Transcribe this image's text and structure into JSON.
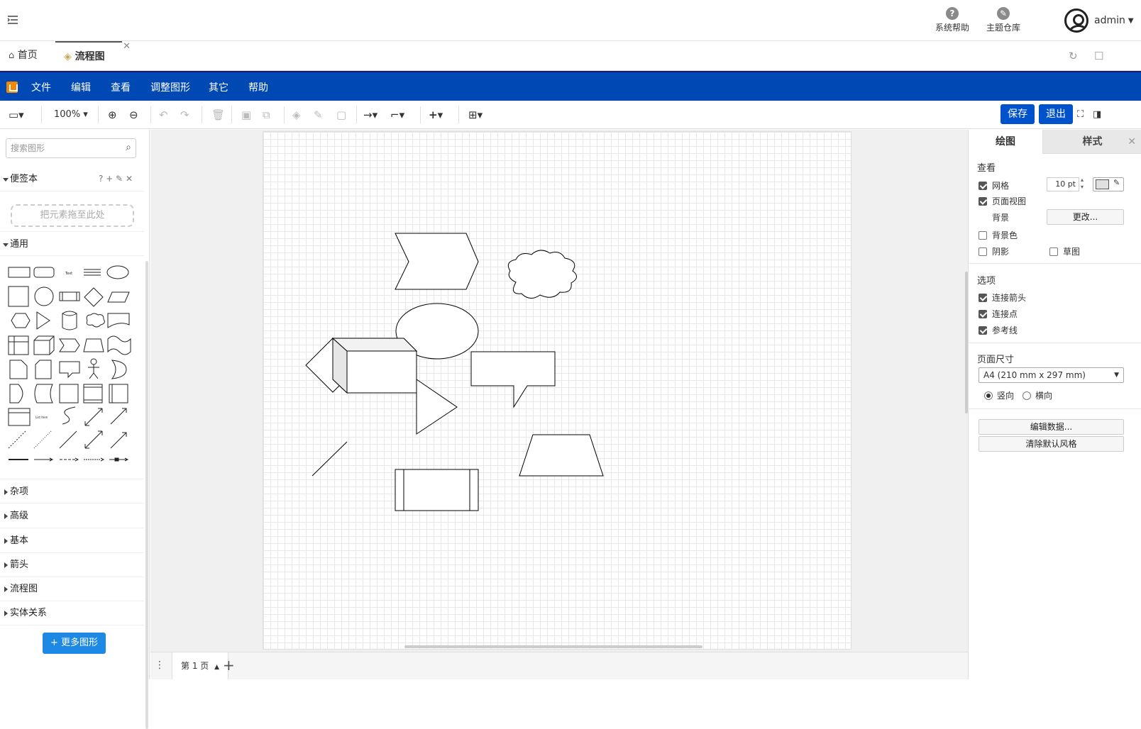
{
  "topbar": {
    "help_label": "系统帮助",
    "theme_label": "主题仓库",
    "user_name": "admin"
  },
  "tabs": [
    {
      "label": "首页"
    },
    {
      "label": "流程图"
    }
  ],
  "menubar": {
    "items": [
      "文件",
      "编辑",
      "查看",
      "调整图形",
      "其它",
      "帮助"
    ]
  },
  "toolbar": {
    "zoom": "100%",
    "save_label": "保存",
    "exit_label": "退出"
  },
  "left": {
    "search_placeholder": "搜索图形",
    "notebook_title": "便签本",
    "notebook_tools": "? + ✎ ✕",
    "dropzone_text": "把元素拖至此处",
    "general_title": "通用",
    "sections": [
      "杂项",
      "高级",
      "基本",
      "箭头",
      "流程图",
      "实体关系"
    ],
    "more_shapes_label": "更多图形"
  },
  "pagebar": {
    "page_label": "第 1 页"
  },
  "right": {
    "tab_draw": "绘图",
    "tab_style": "样式",
    "view_title": "查看",
    "grid_label": "网格",
    "grid_size": "10 pt",
    "page_view_label": "页面视图",
    "background_label": "背景",
    "change_label": "更改...",
    "bgcolor_label": "背景色",
    "shadow_label": "阴影",
    "sketch_label": "草图",
    "options_title": "选项",
    "connect_arrows_label": "连接箭头",
    "connect_points_label": "连接点",
    "guides_label": "参考线",
    "page_size_title": "页面尺寸",
    "page_size_value": "A4 (210 mm x 297 mm)",
    "portrait_label": "竖向",
    "landscape_label": "横向",
    "edit_data_label": "编辑数据...",
    "clear_style_label": "清除默认风格",
    "checks": {
      "grid": true,
      "page_view": true,
      "bgcolor": false,
      "shadow": false,
      "sketch": false,
      "connect_arrows": true,
      "connect_points": true,
      "guides": true
    }
  },
  "colors": {
    "brand_blue": "#0048b3",
    "save_blue": "#0052cc",
    "more_blue": "#1e88e5"
  }
}
